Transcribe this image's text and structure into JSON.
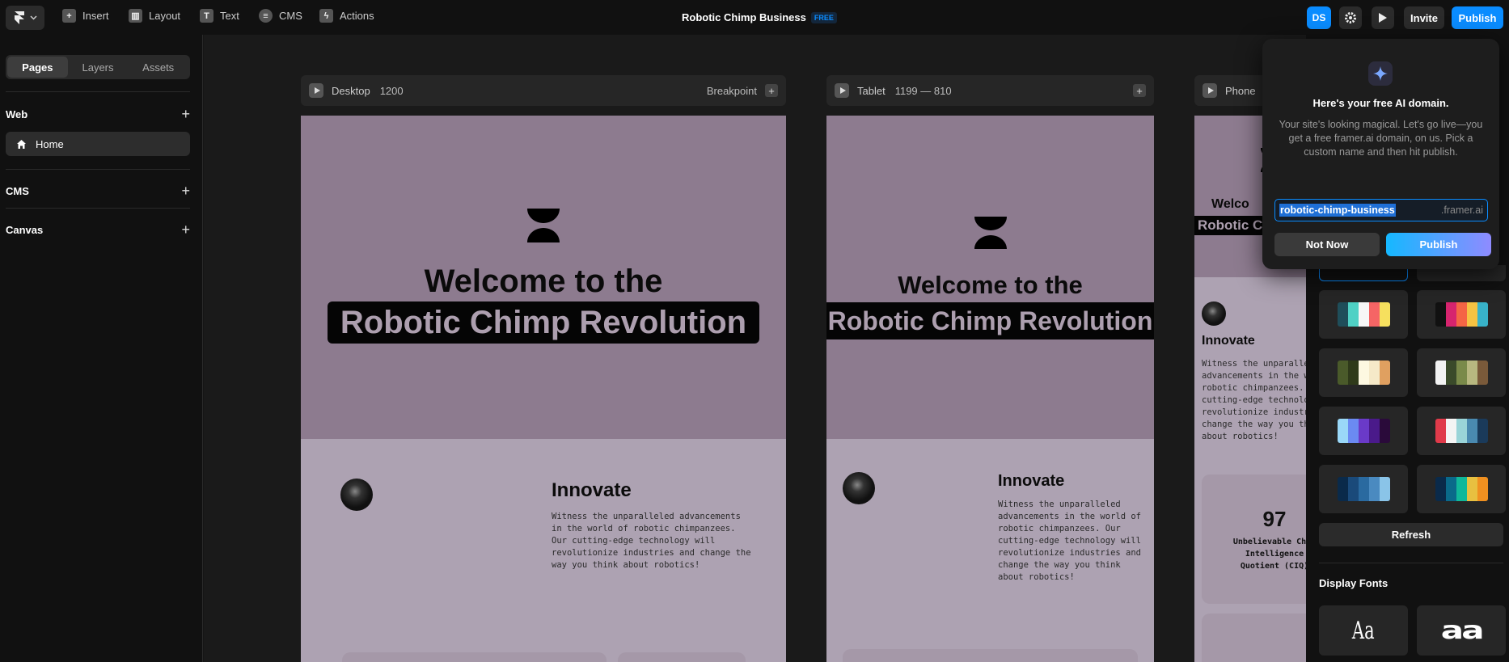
{
  "toolbar": {
    "insert": "Insert",
    "layout": "Layout",
    "text": "Text",
    "cms": "CMS",
    "actions": "Actions",
    "project_title": "Robotic Chimp Business",
    "plan_badge": "FREE",
    "avatar_initials": "DS",
    "invite": "Invite",
    "publish": "Publish"
  },
  "sidebar": {
    "tabs": [
      "Pages",
      "Layers",
      "Assets"
    ],
    "sections": {
      "web": "Web",
      "cms": "CMS",
      "canvas": "Canvas"
    },
    "pages": [
      {
        "label": "Home"
      }
    ]
  },
  "breakpoints": {
    "desktop": {
      "label": "Desktop",
      "width": "1200",
      "add_label": "Breakpoint"
    },
    "tablet": {
      "label": "Tablet",
      "range": "1199 — 810"
    },
    "phone": {
      "label": "Phone"
    }
  },
  "site": {
    "welcome": "Welcome to the",
    "headline": "Robotic Chimp Revolution",
    "welcome_short": "Welco",
    "headline_short": "Robotic Ch",
    "innovate_title": "Innovate",
    "innovate_text": "Witness the unparalleled advancements in the world of robotic chimpanzees. Our cutting-edge technology will revolutionize industries and change the way you think about robotics!",
    "phone_text_lines": [
      "Witness the unparallel",
      "advancements in the wo",
      "robotic chimpanzees.",
      "cutting-edge technolog",
      "revolutionize industri",
      "change the way you thi",
      "about robotics!"
    ],
    "stat_value": "97",
    "stat_label_lines": [
      "Unbelievable Chim",
      "Intelligence",
      "Quotient (CIQ)"
    ]
  },
  "style_panel": {
    "refresh": "Refresh",
    "display_fonts": "Display Fonts",
    "font_samples": [
      "Aa",
      "aa"
    ],
    "palettes": [
      [
        "#1f4e5a",
        "#4fd1c5",
        "#f7f7f7",
        "#f56565",
        "#f6e05e"
      ],
      [
        "#111111",
        "#d6246e",
        "#f56545",
        "#f6c343",
        "#38b2c8"
      ],
      [
        "#4a5a2a",
        "#2f3a1a",
        "#fdf8e1",
        "#f5e9c8",
        "#e0a060"
      ],
      [
        "#f2f2f2",
        "#3a4a2a",
        "#7a8a4a",
        "#b8b880",
        "#7a5a3a"
      ],
      [
        "#9ad8f8",
        "#6b8af2",
        "#6a3ac8",
        "#4a1a8a",
        "#2a0a3a"
      ],
      [
        "#e03a4a",
        "#f4f4f4",
        "#9ad4d8",
        "#4a8ab0",
        "#1a3a5a"
      ],
      [
        "#0a2a4a",
        "#1a4a7a",
        "#2a6aa0",
        "#4a8ac0",
        "#8ac4e8"
      ],
      [
        "#0a2a4a",
        "#0a6a8a",
        "#10b89a",
        "#e8c040",
        "#f09020"
      ]
    ]
  },
  "publish_popup": {
    "heading": "Here's your free AI domain.",
    "body": "Your site's looking magical. Let's go live—you get a free framer.ai domain, on us. Pick a custom name and then hit publish.",
    "domain_value": "robotic-chimp-business",
    "domain_suffix": ".framer.ai",
    "not_now": "Not Now",
    "publish": "Publish"
  },
  "colors": {
    "accent": "#0b8cff",
    "hero_bg": "#8d7b8f",
    "section_bg": "#ada2b2"
  }
}
